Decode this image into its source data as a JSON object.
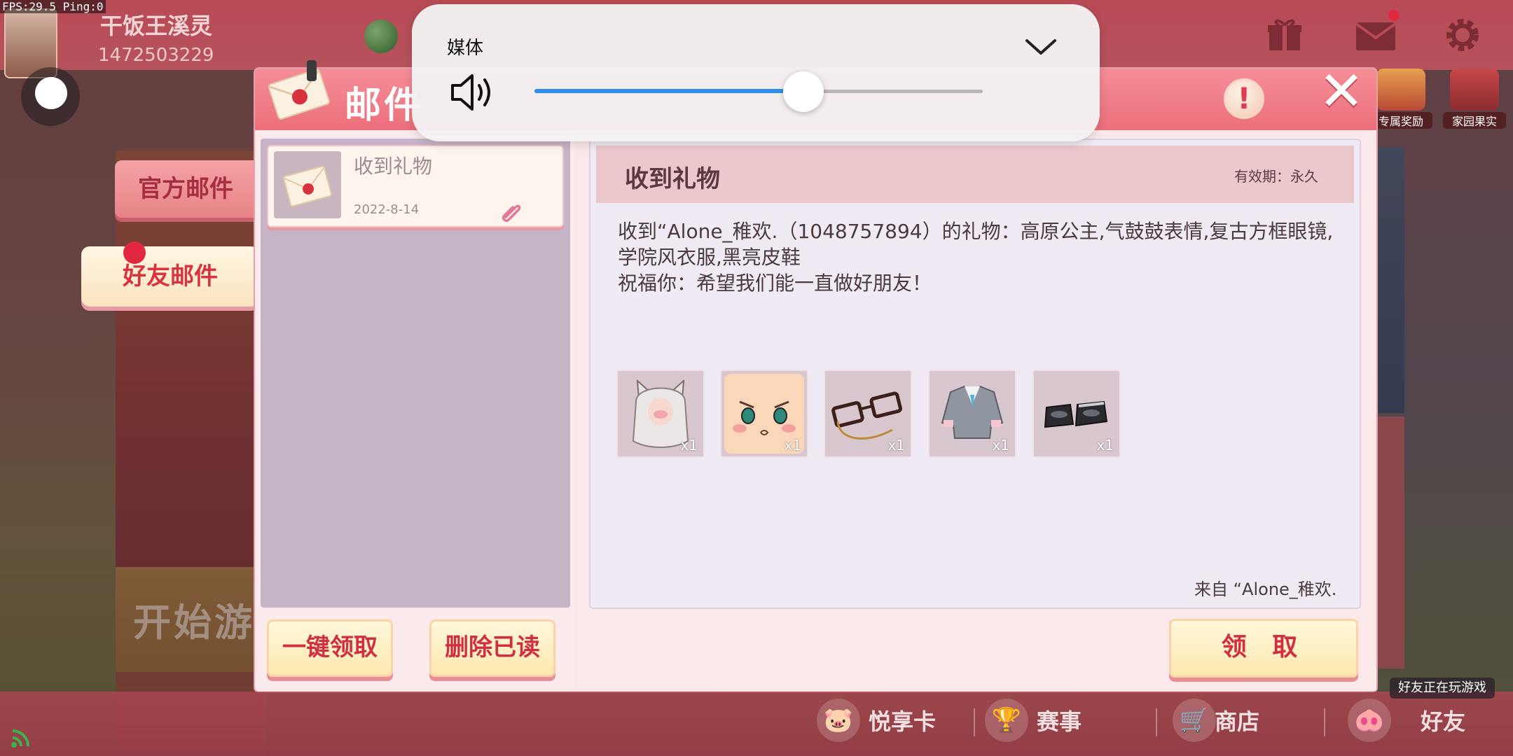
{
  "debug": {
    "fps_text": "FPS:29.5  Ping:0"
  },
  "player": {
    "name": "干饭王溪灵",
    "id": "1472503229"
  },
  "top_rewards": [
    {
      "label": "专属奖励"
    },
    {
      "label": "家园果实"
    }
  ],
  "background": {
    "start_game_text": "开始游"
  },
  "mail": {
    "title": "邮件",
    "tabs": {
      "official": "官方邮件",
      "friend": "好友邮件"
    },
    "list": [
      {
        "title": "收到礼物",
        "date": "2022-8-14",
        "has_attachment": true
      }
    ],
    "buttons": {
      "claim_all": "一键领取",
      "delete_read": "删除已读",
      "claim": "领 取"
    },
    "detail": {
      "title": "收到礼物",
      "validity": "有效期：永久",
      "message": "收到“Alone_稚欢.（1048757894）的礼物：高原公主,气鼓鼓表情,复古方框眼镜,学院风衣服,黑亮皮鞋\n祝福你：希望我们能一直做好朋友！",
      "items": [
        {
          "icon": "white-cat-ear-hair",
          "count": "x1"
        },
        {
          "icon": "pouting-face",
          "count": "x1"
        },
        {
          "icon": "retro-square-glasses",
          "count": "x1"
        },
        {
          "icon": "school-uniform",
          "count": "x1"
        },
        {
          "icon": "black-shoes",
          "count": "x1"
        }
      ],
      "from": "来自 “Alone_稚欢."
    }
  },
  "bottom_nav": [
    {
      "label": "悦享卡",
      "icon": "pig-icon"
    },
    {
      "label": "赛事",
      "icon": "trophy-icon"
    },
    {
      "label": "商店",
      "icon": "cart-icon"
    },
    {
      "label": "好友",
      "icon": "friend-pig-icon"
    }
  ],
  "friends_playing": "好友正在玩游戏",
  "volume": {
    "label": "媒体",
    "level": 0.6
  },
  "colors": {
    "accent_pink": "#ec6f7b",
    "button_text": "#d02f3f",
    "slider_blue": "#2f8ff0"
  }
}
